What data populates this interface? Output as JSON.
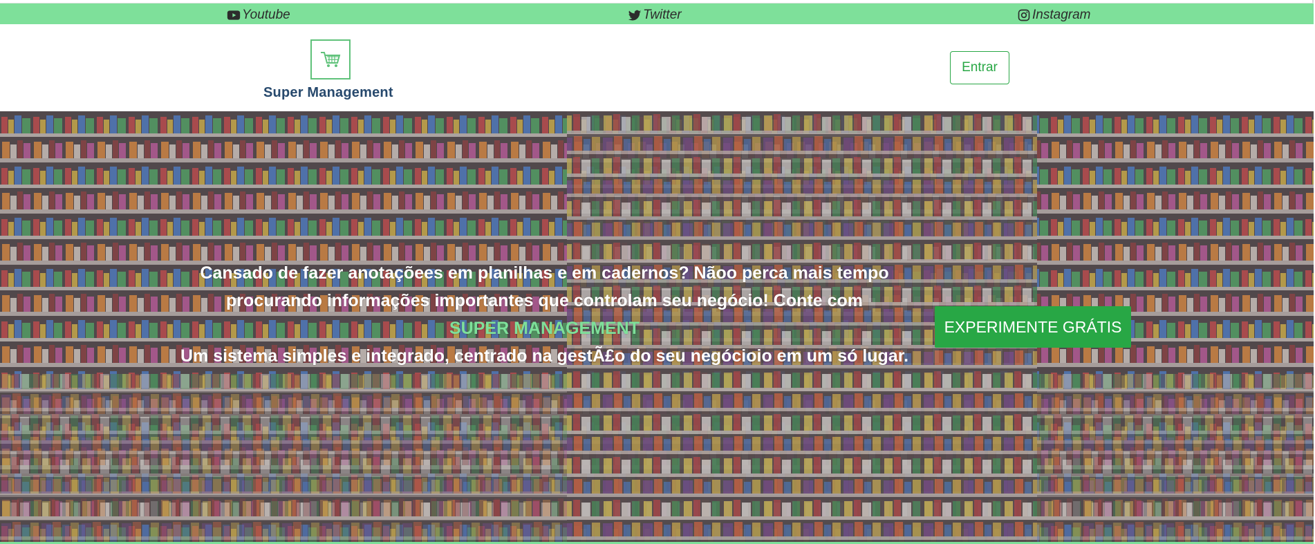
{
  "social": {
    "youtube": {
      "label": "Youtube",
      "icon": "youtube-icon"
    },
    "twitter": {
      "label": "Twitter",
      "icon": "twitter-icon"
    },
    "instagram": {
      "label": "Instagram",
      "icon": "instagram-icon"
    }
  },
  "header": {
    "logo_icon": "shopping-cart-icon",
    "brand": "Super Management",
    "login_label": "Entrar"
  },
  "hero": {
    "line1": "Cansado de fazer anotaçõees em planilhas e em cadernos? Nãoo perca mais tempo procurando informações importantes que controlam seu negócio! Conte com",
    "brand": "Super Management",
    "line2": "Um sistema simples e integrado, centrado na gestÃ£o do seu negócioio em um só lugar.",
    "cta_label": "EXPERIMENTE GRÁTIS",
    "background": "supermarket-shelves-photo"
  },
  "colors": {
    "accent": "#7ee09a",
    "primary_green": "#28a745",
    "brand_blue": "#27496d"
  }
}
